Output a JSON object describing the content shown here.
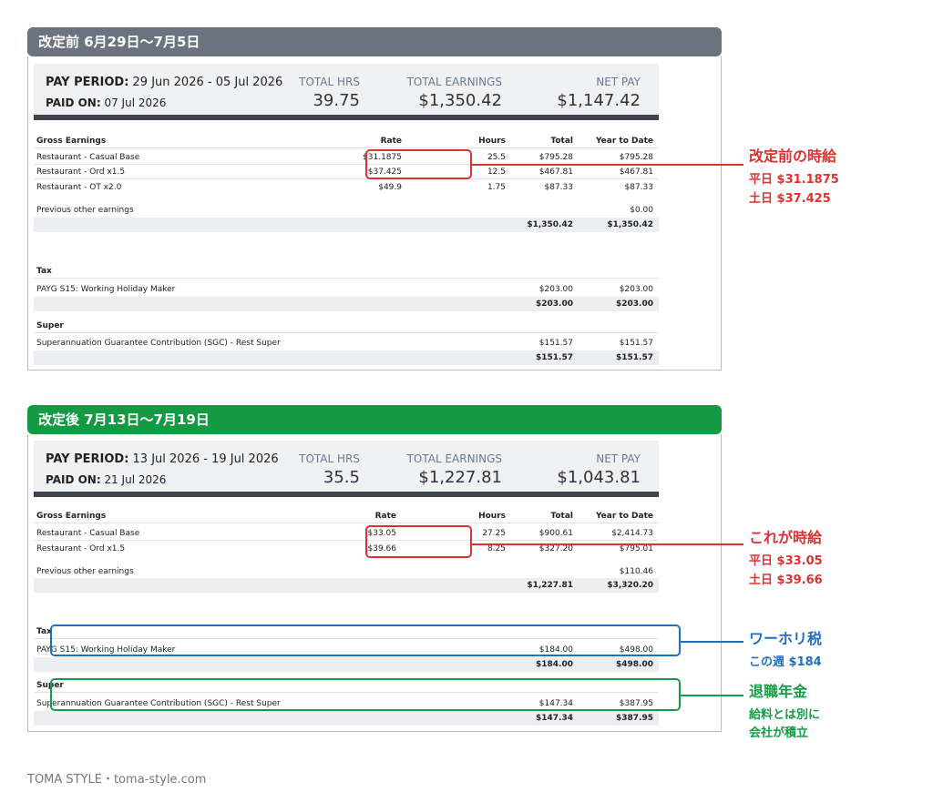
{
  "before": {
    "banner": "改定前 6月29日〜7月5日",
    "pay_period_label": "PAY PERIOD:",
    "pay_period": "29 Jun 2026 - 05 Jul 2026",
    "paid_on_label": "PAID ON:",
    "paid_on": "07 Jul 2026",
    "total_hrs_label": "TOTAL HRS",
    "total_hrs": "39.75",
    "total_earnings_label": "TOTAL EARNINGS",
    "total_earnings": "$1,350.42",
    "net_pay_label": "NET PAY",
    "net_pay": "$1,147.42",
    "columns": {
      "name": "Gross Earnings",
      "rate": "Rate",
      "hours": "Hours",
      "total": "Total",
      "ytd": "Year to Date"
    },
    "earnings": [
      {
        "name": "Restaurant - Casual Base",
        "rate": "$31.1875",
        "hours": "25.5",
        "total": "$795.28",
        "ytd": "$795.28"
      },
      {
        "name": "Restaurant - Ord x1.5",
        "rate": "$37.425",
        "hours": "12.5",
        "total": "$467.81",
        "ytd": "$467.81"
      },
      {
        "name": "Restaurant - OT x2.0",
        "rate": "$49.9",
        "hours": "1.75",
        "total": "$87.33",
        "ytd": "$87.33"
      }
    ],
    "previous": {
      "name": "Previous other earnings",
      "ytd": "$0.00"
    },
    "earnings_subtotal": {
      "total": "$1,350.42",
      "ytd": "$1,350.42"
    },
    "tax_title": "Tax",
    "tax_row": {
      "name": "PAYG S15: Working Holiday Maker",
      "total": "$203.00",
      "ytd": "$203.00"
    },
    "tax_subtotal": {
      "total": "$203.00",
      "ytd": "$203.00"
    },
    "super_title": "Super",
    "super_row": {
      "name": "Superannuation Guarantee Contribution (SGC) - Rest Super",
      "total": "$151.57",
      "ytd": "$151.57"
    },
    "super_subtotal": {
      "total": "$151.57",
      "ytd": "$151.57"
    }
  },
  "after": {
    "banner": "改定後 7月13日〜7月19日",
    "pay_period_label": "PAY PERIOD:",
    "pay_period": "13 Jul 2026 - 19 Jul 2026",
    "paid_on_label": "PAID ON:",
    "paid_on": "21 Jul 2026",
    "total_hrs_label": "TOTAL HRS",
    "total_hrs": "35.5",
    "total_earnings_label": "TOTAL EARNINGS",
    "total_earnings": "$1,227.81",
    "net_pay_label": "NET PAY",
    "net_pay": "$1,043.81",
    "columns": {
      "name": "Gross Earnings",
      "rate": "Rate",
      "hours": "Hours",
      "total": "Total",
      "ytd": "Year to Date"
    },
    "earnings": [
      {
        "name": "Restaurant - Casual Base",
        "rate": "$33.05",
        "hours": "27.25",
        "total": "$900.61",
        "ytd": "$2,414.73"
      },
      {
        "name": "Restaurant - Ord x1.5",
        "rate": "$39.66",
        "hours": "8.25",
        "total": "$327.20",
        "ytd": "$795.01"
      }
    ],
    "previous": {
      "name": "Previous other earnings",
      "ytd": "$110.46"
    },
    "earnings_subtotal": {
      "total": "$1,227.81",
      "ytd": "$3,320.20"
    },
    "tax_title": "Tax",
    "tax_row": {
      "name": "PAYG S15: Working Holiday Maker",
      "total": "$184.00",
      "ytd": "$498.00"
    },
    "tax_subtotal": {
      "total": "$184.00",
      "ytd": "$498.00"
    },
    "super_title": "Super",
    "super_row": {
      "name": "Superannuation Guarantee Contribution (SGC) - Rest Super",
      "total": "$147.34",
      "ytd": "$387.95"
    },
    "super_subtotal": {
      "total": "$147.34",
      "ytd": "$387.95"
    }
  },
  "annotations": {
    "before_rate": {
      "title": "改定前の時給",
      "line1": "平日 $31.1875",
      "line2": "土日 $37.425"
    },
    "after_rate": {
      "title": "これが時給",
      "line1": "平日 $33.05",
      "line2": "土日 $39.66"
    },
    "tax": {
      "title": "ワーホリ税",
      "line1": "この週 $184"
    },
    "super": {
      "title": "退職年金",
      "line1": "給料とは別に",
      "line2": "会社が積立"
    }
  },
  "colors": {
    "red": "#e03131",
    "blue": "#1f6fc5",
    "green": "#169c46",
    "gray_banner": "#6b7280",
    "green_banner": "#139a43"
  },
  "footer": "TOMA STYLE・toma-style.com"
}
